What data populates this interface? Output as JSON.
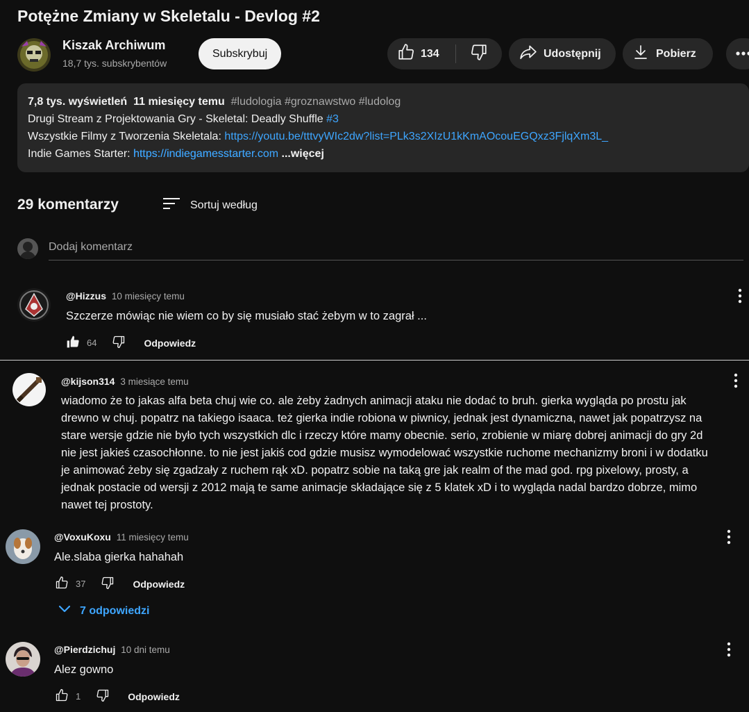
{
  "video": {
    "title": "Potężne Zmiany w Skeletalu - Devlog #2"
  },
  "channel": {
    "name": "Kiszak Archiwum",
    "subscribers": "18,7 tys. subskrybentów",
    "subscribe_label": "Subskrybuj"
  },
  "actions": {
    "likes": "134",
    "share_label": "Udostępnij",
    "download_label": "Pobierz"
  },
  "description": {
    "views": "7,8 tys. wyświetleń",
    "age": "11 miesięcy temu",
    "tags": "#ludologia #groznawstwo #ludolog",
    "line1_text": "Drugi Stream z Projektowania Gry - Skeletal: Deadly Shuffle",
    "line1_tag": "#3",
    "line2_text": "Wszystkie Filmy z Tworzenia Skeletala:",
    "line2_link": "https://youtu.be/tttvyWIc2dw?list=PLk3s2XIzU1kKmAOcouEGQxz3FjlqXm3L_",
    "line3_text": "Indie Games Starter:",
    "line3_link": "https://indiegamesstarter.com",
    "more_label": "...więcej"
  },
  "comments_section": {
    "count_label": "29 komentarzy",
    "sort_label": "Sortuj według",
    "add_placeholder": "Dodaj komentarz"
  },
  "comments": [
    {
      "author": "@Hizzus",
      "time": "10 miesięcy temu",
      "text": "Szczerze mówiąc nie wiem co by się musiało stać żebym w to zagrał ...",
      "likes": "64",
      "reply_label": "Odpowiedz"
    },
    {
      "author": "@kijson314",
      "time": "3 miesiące temu",
      "text_lines": [
        "wiadomo że to jakas alfa beta chuj wie co. ale żeby żadnych animacji ataku nie dodać to bruh. gierka wygląda po prostu jak",
        "drewno w chuj. popatrz na takiego isaaca. też gierka indie robiona w piwnicy, jednak jest dynamiczna, nawet jak popatrzysz na",
        "stare wersje gdzie nie było tych wszystkich dlc i rzeczy które mamy obecnie. serio, zrobienie w miarę dobrej animacji do gry 2d",
        "nie jest jakieś czasochłonne. to nie jest jakiś cod gdzie musisz wymodelować wszystkie ruchome mechanizmy broni i w dodatku",
        "je animować żeby się zgadzały z ruchem rąk xD. popatrz sobie na taką gre jak realm of the mad god. rpg pixelowy, prosty, a",
        "jednak postacie od wersji z 2012 mają te same animacje składające się z 5 klatek xD i to wygląda nadal bardzo dobrze, mimo",
        "nawet tej prostoty."
      ]
    },
    {
      "author": "@VoxuKoxu",
      "time": "11 miesięcy temu",
      "text": "Ale.slaba gierka hahahah",
      "likes": "37",
      "reply_label": "Odpowiedz",
      "replies_label": "7 odpowiedzi"
    },
    {
      "author": "@Pierdzichuj",
      "time": "10 dni temu",
      "text": "Alez gowno",
      "likes": "1",
      "reply_label": "Odpowiedz"
    }
  ],
  "colors": {
    "background": "#0f0f0f",
    "surface": "#272727",
    "link": "#3ea6ff",
    "secondary_text": "#aaaaaa"
  }
}
